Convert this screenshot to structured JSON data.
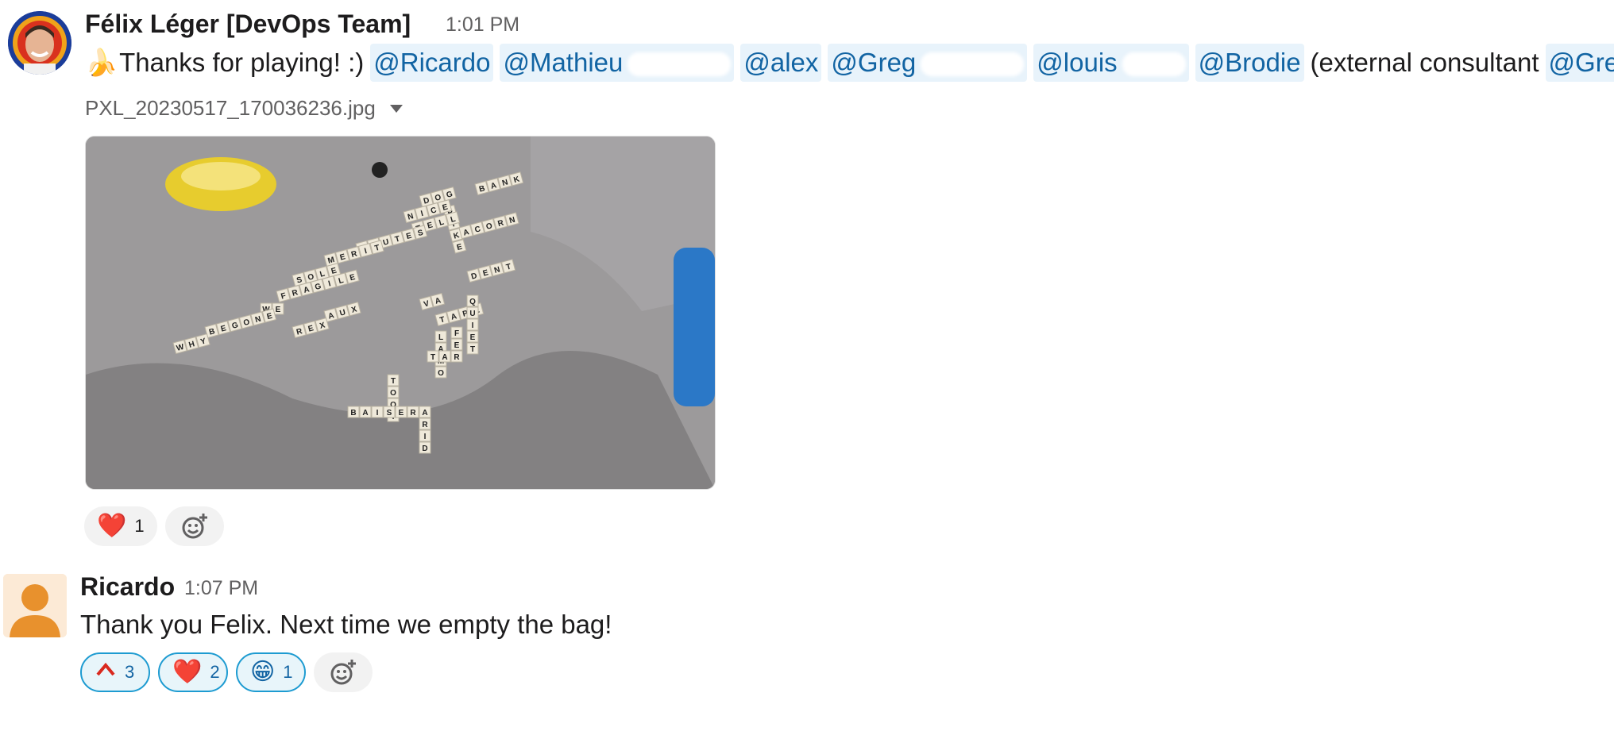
{
  "message1": {
    "author": "Félix Léger [DevOps Team]",
    "time": "1:01 PM",
    "emoji": "🍌",
    "text_lead": "Thanks for playing! :)",
    "mentions": [
      "@Ricardo",
      "@Mathieu",
      "@alex",
      "@Greg",
      "@louis",
      "@Brodie"
    ],
    "text_paren_open": "(external consultant",
    "paren_mention": "@Greg",
    "text_paren_close": "!)",
    "attachment_name": "PXL_20230517_170036236.jpg",
    "photo_tiles": [
      "BANK",
      "DOG",
      "PIKE",
      "NICE",
      "TELL",
      "ACORN",
      "TOUTES",
      "MERIT",
      "SOLE",
      "FRAGILE",
      "WE",
      "AUX",
      "REX",
      "BEGONE",
      "WHY",
      "VA",
      "TAPE",
      "LAMO",
      "TAO",
      "TOOT",
      "BAISER",
      "ARID",
      "QUIET",
      "DENT",
      "FER"
    ],
    "reactions": [
      {
        "emoji": "❤️",
        "count": "1"
      }
    ]
  },
  "message2": {
    "author": "Ricardo",
    "time": "1:07 PM",
    "text": "Thank you Felix.  Next time we empty the bag!",
    "reactions": [
      {
        "emoji": "^",
        "count": "3"
      },
      {
        "emoji": "❤️",
        "count": "2"
      },
      {
        "emoji": "😁",
        "count": "1"
      }
    ]
  },
  "colors": {
    "mention_text": "#1264a3",
    "mention_bg": "#e8f3fb",
    "selected_reaction_border": "#1d9bd1",
    "avatar_orange": "#e8912d"
  }
}
